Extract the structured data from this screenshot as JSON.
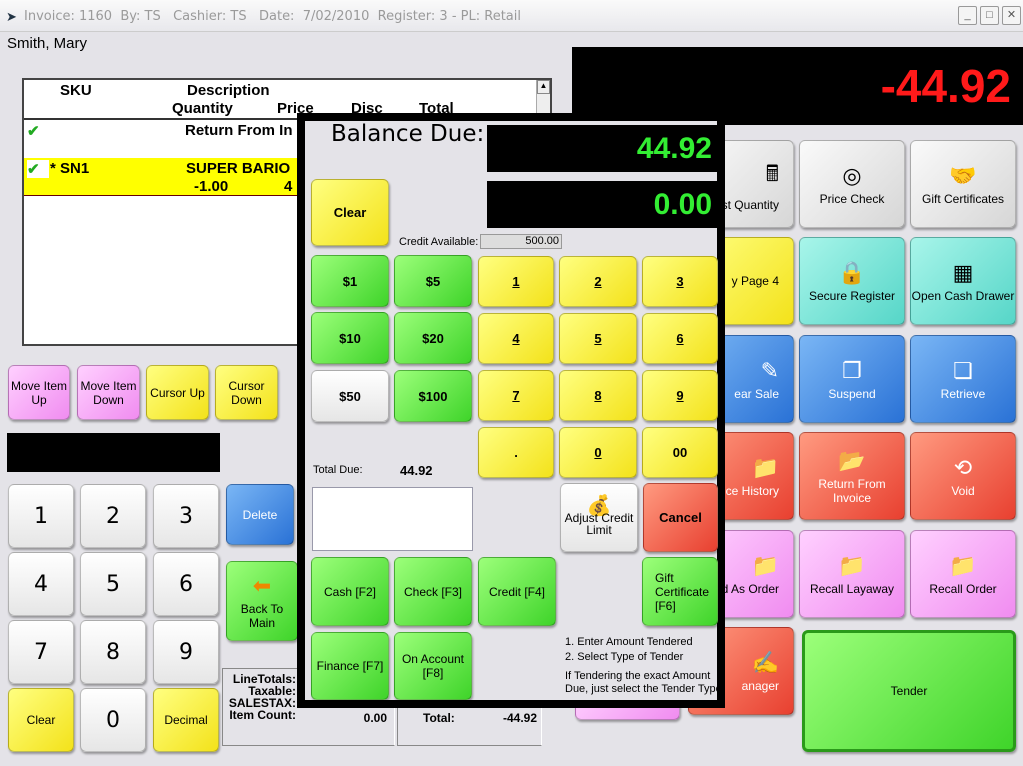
{
  "window": {
    "title": "Invoice: 1160  By: TS   Cashier: TS   Date:  7/02/2010  Register: 3 - PL: Retail",
    "minimize": "_",
    "maximize": "□",
    "close": "✕"
  },
  "customer": "Smith, Mary",
  "table": {
    "headers": {
      "sku": "SKU",
      "description": "Description",
      "quantity": "Quantity",
      "price": "Price",
      "disc": "Disc",
      "total": "Total"
    },
    "rows": [
      {
        "sku": "",
        "description": "Return From In",
        "quantity": "",
        "price": "",
        "highlight": false
      },
      {
        "sku": "* SN1",
        "description": "SUPER BARIO",
        "quantity": "-1.00",
        "price": "4",
        "highlight": true
      }
    ]
  },
  "left_buttons": [
    "Move Item Up",
    "Move Item Down",
    "Cursor Up",
    "Cursor Down"
  ],
  "keypad": [
    "1",
    "2",
    "3",
    "4",
    "5",
    "6",
    "7",
    "8",
    "9",
    "Clear",
    "0",
    "Decimal"
  ],
  "delete": "Delete",
  "back_to_main": "Back To Main",
  "totals": {
    "line_totals": "LineTotals:",
    "taxable": "Taxable:",
    "salestax": "SALESTAX:",
    "item_count_label": "Item Count:",
    "item_count": "0.00",
    "total_label": "Total:",
    "total": "-44.92"
  },
  "main_display": {
    "value": "-44.92",
    "color": "#ff1a1a"
  },
  "right_grid": [
    {
      "label": "st Quantity",
      "color": "gry",
      "icon": "calculator-icon",
      "glyph": "🖩"
    },
    {
      "label": "Price Check",
      "color": "gry",
      "icon": "coin-icon",
      "glyph": "◎"
    },
    {
      "label": "Gift Certificates",
      "color": "gry",
      "icon": "handshake-icon",
      "glyph": "🤝"
    },
    {
      "label": "y Page 4",
      "color": "yel",
      "icon": "",
      "glyph": ""
    },
    {
      "label": "Secure Register",
      "color": "tea",
      "icon": "lock-icon",
      "glyph": "🔒"
    },
    {
      "label": "Open Cash Drawer",
      "color": "tea",
      "icon": "cash-register-icon",
      "glyph": "▦"
    },
    {
      "label": "ear Sale",
      "color": "blu",
      "icon": "eraser-icon",
      "glyph": "✎"
    },
    {
      "label": "Suspend",
      "color": "blu",
      "icon": "folders-icon",
      "glyph": "❐"
    },
    {
      "label": "Retrieve",
      "color": "blu",
      "icon": "retrieve-icon",
      "glyph": "❏"
    },
    {
      "label": "ice History",
      "color": "red",
      "icon": "folder-icon",
      "glyph": "📁"
    },
    {
      "label": "Return From Invoice",
      "color": "red",
      "icon": "folder-icon",
      "glyph": "📂"
    },
    {
      "label": "Void",
      "color": "red",
      "icon": "void-icon",
      "glyph": "⟲"
    },
    {
      "label": "d As Order",
      "color": "pnk",
      "icon": "folder-icon",
      "glyph": "📁"
    },
    {
      "label": "Recall Layaway",
      "color": "pnk",
      "icon": "folder-icon",
      "glyph": "📁"
    },
    {
      "label": "Recall Order",
      "color": "pnk",
      "icon": "folder-icon",
      "glyph": "📁"
    },
    {
      "label": "anager",
      "color": "red",
      "icon": "manager-icon",
      "glyph": "✍"
    }
  ],
  "tender": "Tender",
  "dialog": {
    "balance_due_label": "Balance Due:",
    "balance_due": "44.92",
    "tendered": "0.00",
    "display_color": "#33ee33",
    "clear": "Clear",
    "credit_available_label": "Credit Available:",
    "credit_available": "500.00",
    "money": [
      "$1",
      "$5",
      "$10",
      "$20",
      "$50",
      "$100"
    ],
    "numpad": [
      "1",
      "2",
      "3",
      "4",
      "5",
      "6",
      "7",
      "8",
      "9",
      ".",
      "0",
      "00"
    ],
    "total_due_label": "Total Due:",
    "total_due": "44.92",
    "adjust_credit": "Adjust Credit Limit",
    "cancel": "Cancel",
    "tenders": [
      "Cash [F2]",
      "Check [F3]",
      "Credit [F4]",
      "Gift Certificate [F6]",
      "Finance [F7]",
      "On Account [F8]"
    ],
    "instructions": [
      "1. Enter Amount Tendered",
      "2. Select Type of Tender",
      "If Tendering the exact Amount Due, just select the Tender Type"
    ]
  }
}
